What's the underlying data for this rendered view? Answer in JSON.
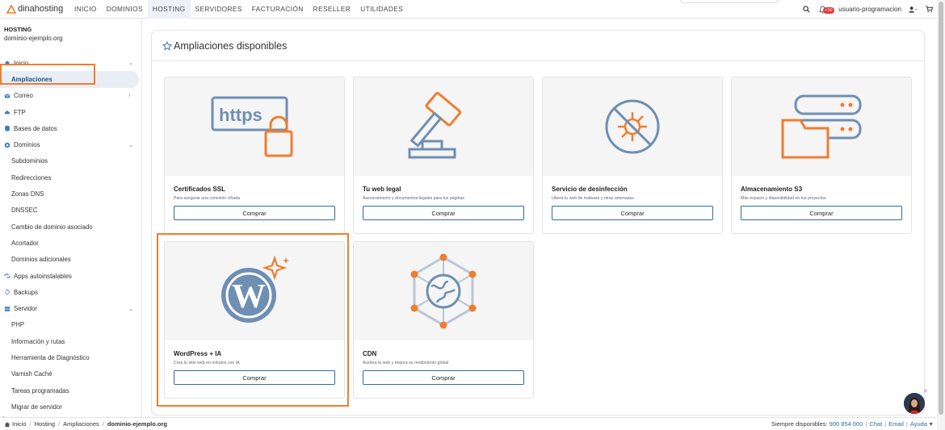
{
  "brand": {
    "name": "dinahosting",
    "accent": "#f07d2e",
    "link": "#2d6da3"
  },
  "nav": {
    "items": [
      {
        "label": "INICIO",
        "active": false
      },
      {
        "label": "DOMINIOS",
        "active": false
      },
      {
        "label": "HOSTING",
        "active": true
      },
      {
        "label": "SERVIDORES",
        "active": false
      },
      {
        "label": "FACTURACIÓN",
        "active": false
      },
      {
        "label": "RESELLER",
        "active": false
      },
      {
        "label": "UTILIDADES",
        "active": false
      }
    ],
    "notifications": "+10",
    "user": "usuario-programacion"
  },
  "sidebar": {
    "section": "HOSTING",
    "domain": "dominio-ejemplo.org",
    "items": [
      {
        "label": "Inicio",
        "icon": "home-icon",
        "chev": "⌄"
      },
      {
        "label": "Ampliaciones",
        "active": true,
        "sub": true
      },
      {
        "label": "Correo",
        "icon": "mail-icon",
        "chev": "›"
      },
      {
        "label": "FTP",
        "icon": "cloud-icon"
      },
      {
        "label": "Bases de datos",
        "icon": "database-icon"
      },
      {
        "label": "Dominios",
        "icon": "globe-icon",
        "chev": "⌄"
      },
      {
        "label": "Subdominios",
        "sub": true
      },
      {
        "label": "Redirecciones",
        "sub": true
      },
      {
        "label": "Zonas DNS",
        "sub": true
      },
      {
        "label": "DNSSEC",
        "sub": true
      },
      {
        "label": "Cambio de dominio asociado",
        "sub": true
      },
      {
        "label": "Acortador",
        "sub": true
      },
      {
        "label": "Dominios adicionales",
        "sub": true
      },
      {
        "label": "Apps autoinstalables",
        "icon": "apps-icon"
      },
      {
        "label": "Backups",
        "icon": "backup-icon"
      },
      {
        "label": "Servidor",
        "icon": "server-icon",
        "chev": "⌄"
      },
      {
        "label": "PHP",
        "sub": true
      },
      {
        "label": "Información y rutas",
        "sub": true
      },
      {
        "label": "Herramienta de Diagnóstico",
        "sub": true
      },
      {
        "label": "Varnish Caché",
        "sub": true
      },
      {
        "label": "Tareas programadas",
        "sub": true
      },
      {
        "label": "Migrar de servidor",
        "sub": true
      }
    ]
  },
  "main": {
    "title": "Ampliaciones disponibles",
    "cards": [
      {
        "title": "Certificados SSL",
        "desc": "Para asegurar una conexión cifrada",
        "button": "Comprar",
        "icon": "https-lock-icon"
      },
      {
        "title": "Tu web legal",
        "desc": "Asesoramiento y documentos legales para tus páginas",
        "button": "Comprar",
        "icon": "gavel-icon"
      },
      {
        "title": "Servicio de desinfección",
        "desc": "Libera tu web de malware y otras amenazas",
        "button": "Comprar",
        "icon": "no-virus-icon"
      },
      {
        "title": "Almacenamiento S3",
        "desc": "Más espacio y disponibilidad en tus proyectos",
        "button": "Comprar",
        "icon": "storage-folder-icon"
      },
      {
        "title": "WordPress + IA",
        "desc": "Crea tu sitio web en minutos con IA",
        "button": "Comprar",
        "icon": "wordpress-sparkle-icon"
      },
      {
        "title": "CDN",
        "desc": "Acelera tu web y mejora su rendimiento global",
        "button": "Comprar",
        "icon": "cdn-network-icon"
      }
    ]
  },
  "footer": {
    "breadcrumb": [
      "Inicio",
      "Hosting",
      "Ampliaciones",
      "dominio-ejemplo.org"
    ],
    "contact_label": "Siempre disponibles:",
    "phone": "900 854 000",
    "chat": "Chat",
    "email": "Email",
    "help": "Ayuda"
  }
}
